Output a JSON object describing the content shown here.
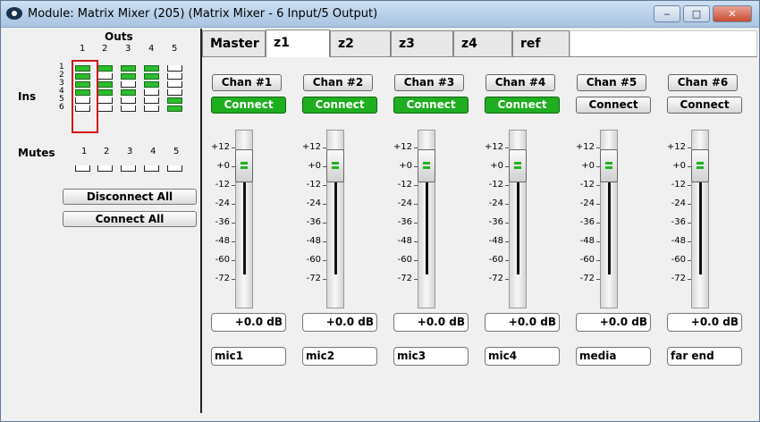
{
  "window": {
    "title": "Module: Matrix Mixer (205) (Matrix Mixer - 6 Input/5 Output)",
    "minimize": "‒",
    "maximize": "□",
    "close": "✕"
  },
  "left": {
    "outs_label": "Outs",
    "ins_label": "Ins",
    "mutes_label": "Mutes",
    "out_numbers": [
      "1",
      "2",
      "3",
      "4",
      "5"
    ],
    "in_numbers": [
      "1",
      "2",
      "3",
      "4",
      "5",
      "6"
    ],
    "mute_numbers": [
      "1",
      "2",
      "3",
      "4",
      "5"
    ],
    "matrix": [
      [
        1,
        1,
        1,
        1,
        0
      ],
      [
        1,
        0,
        1,
        1,
        0
      ],
      [
        1,
        1,
        0,
        1,
        0
      ],
      [
        1,
        1,
        1,
        0,
        0
      ],
      [
        0,
        0,
        0,
        0,
        1
      ],
      [
        0,
        0,
        0,
        0,
        1
      ]
    ],
    "mutes": [
      0,
      0,
      0,
      0,
      0
    ],
    "disconnect_all": "Disconnect All",
    "connect_all": "Connect All"
  },
  "tabs": [
    "Master",
    "z1",
    "z2",
    "z3",
    "z4",
    "ref"
  ],
  "active_tab": "z1",
  "scale_labels": [
    "+12",
    "+0",
    "-12",
    "-24",
    "-36",
    "-48",
    "-60",
    "-72"
  ],
  "channels": [
    {
      "label": "Chan #1",
      "connect": "Connect",
      "connected": true,
      "gain": "+0.0 dB",
      "name": "mic1"
    },
    {
      "label": "Chan #2",
      "connect": "Connect",
      "connected": true,
      "gain": "+0.0 dB",
      "name": "mic2"
    },
    {
      "label": "Chan #3",
      "connect": "Connect",
      "connected": true,
      "gain": "+0.0 dB",
      "name": "mic3"
    },
    {
      "label": "Chan #4",
      "connect": "Connect",
      "connected": true,
      "gain": "+0.0 dB",
      "name": "mic4"
    },
    {
      "label": "Chan #5",
      "connect": "Connect",
      "connected": false,
      "gain": "+0.0 dB",
      "name": "media"
    },
    {
      "label": "Chan #6",
      "connect": "Connect",
      "connected": false,
      "gain": "+0.0 dB",
      "name": "far end"
    }
  ],
  "colors": {
    "connected": "#1fae1f",
    "matrix_on": "#2bbd2b",
    "selection": "#d01818"
  }
}
